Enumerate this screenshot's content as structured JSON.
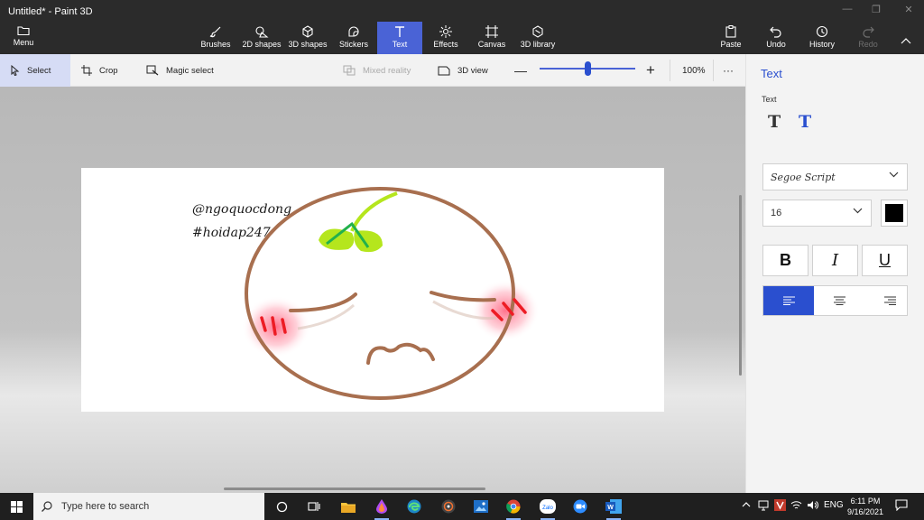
{
  "window": {
    "title": "Untitled* - Paint 3D"
  },
  "menu": {
    "label": "Menu"
  },
  "ribbon": {
    "tools": [
      {
        "label": "Brushes",
        "icon": "brush-icon"
      },
      {
        "label": "2D shapes",
        "icon": "2d-shapes-icon"
      },
      {
        "label": "3D shapes",
        "icon": "3d-shapes-icon"
      },
      {
        "label": "Stickers",
        "icon": "stickers-icon"
      },
      {
        "label": "Text",
        "icon": "text-icon",
        "active": true
      },
      {
        "label": "Effects",
        "icon": "effects-icon"
      },
      {
        "label": "Canvas",
        "icon": "canvas-icon"
      },
      {
        "label": "3D library",
        "icon": "3d-library-icon"
      }
    ],
    "actions": [
      {
        "label": "Paste",
        "icon": "paste-icon"
      },
      {
        "label": "Undo",
        "icon": "undo-icon"
      },
      {
        "label": "History",
        "icon": "history-icon"
      },
      {
        "label": "Redo",
        "icon": "redo-icon",
        "disabled": true
      }
    ]
  },
  "subtoolbar": {
    "select": "Select",
    "crop": "Crop",
    "magic_select": "Magic select",
    "mixed_reality": "Mixed reality",
    "view_3d": "3D view",
    "zoom_percent": "100%",
    "zoom_level": 0.5
  },
  "canvas": {
    "text_lines": [
      "@ngoquocdong",
      "#hoidap247"
    ],
    "colors": {
      "face_outline": "#a86f4f",
      "leaf": "#b5e61d",
      "leaf_vein": "#22b14c",
      "blush": "#ff5a78",
      "blush_marks": "#ed1c24"
    }
  },
  "panel": {
    "title": "Text",
    "section_label": "Text",
    "font_name": "Segoe Script",
    "font_size": "16",
    "text_color": "#000000",
    "bold": "B",
    "italic": "I",
    "underline": "U",
    "alignment": "left"
  },
  "taskbar": {
    "search_placeholder": "Type here to search",
    "time": "6:11 PM",
    "date": "9/16/2021",
    "language": "ENG"
  },
  "colors": {
    "accent": "#2a4fcf",
    "active_tool": "#4a63d6",
    "titlebar": "#2b2b2b"
  }
}
